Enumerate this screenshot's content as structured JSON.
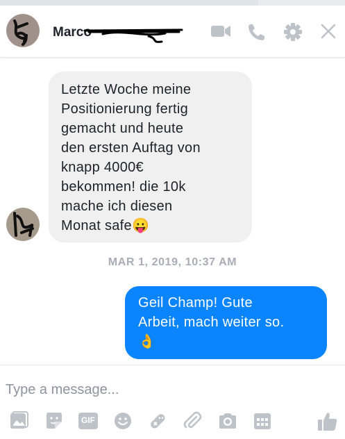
{
  "header": {
    "contact_name": "Marco",
    "icons": [
      "video-icon",
      "phone-icon",
      "gear-icon",
      "close-icon"
    ]
  },
  "messages": [
    {
      "direction": "incoming",
      "lines": [
        "Letzte Woche meine",
        "Positionierung fertig",
        "gemacht und heute",
        "den ersten Auftag von",
        "knapp 4000€",
        "bekommen! die 10k",
        "mache ich diesen",
        "Monat safe"
      ],
      "emoji": "😛"
    },
    {
      "direction": "outgoing",
      "lines": [
        "Geil Champ! Gute",
        "Arbeit, mach weiter so."
      ],
      "emoji": "👌"
    }
  ],
  "timestamp": "MAR 1, 2019, 10:37 AM",
  "composer": {
    "placeholder": "Type a message...",
    "toolbar": [
      "photo-icon",
      "sticker-icon",
      "gif-icon",
      "emoji-icon",
      "game-icon",
      "attach-icon",
      "camera-icon",
      "plan-icon",
      "like-icon"
    ],
    "gif_label": "GIF"
  },
  "colors": {
    "accent": "#0a84ff",
    "icon_gray": "#bec3c9",
    "incoming_bubble": "#f1f0f0"
  }
}
